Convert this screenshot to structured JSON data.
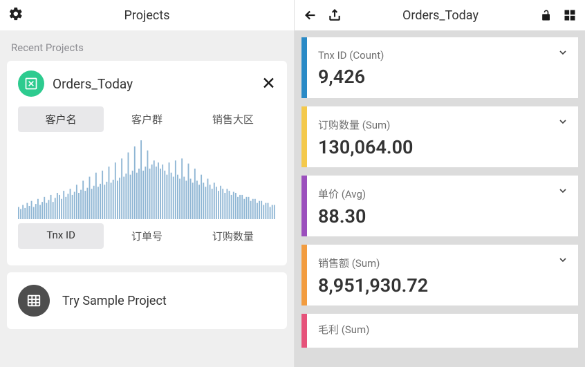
{
  "left": {
    "title": "Projects",
    "recent_label": "Recent Projects",
    "project": {
      "name": "Orders_Today",
      "tabs_top": [
        "客户名",
        "客户群",
        "销售大区"
      ],
      "tabs_bottom": [
        "Tnx ID",
        "订单号",
        "订购数量"
      ],
      "active_top": 0,
      "active_bottom": 0
    },
    "sample_label": "Try Sample Project"
  },
  "right": {
    "title": "Orders_Today",
    "metrics": [
      {
        "label": "Tnx ID (Count)",
        "value": "9,426",
        "color": "#2a8ac6"
      },
      {
        "label": "订购数量 (Sum)",
        "value": "130,064.00",
        "color": "#f4c94b"
      },
      {
        "label": "单价 (Avg)",
        "value": "88.30",
        "color": "#9b4fbd"
      },
      {
        "label": "销售额 (Sum)",
        "value": "8,951,930.72",
        "color": "#f29c3f"
      },
      {
        "label": "毛利 (Sum)",
        "value": "",
        "color": "#e6527a"
      }
    ]
  },
  "chart_data": {
    "type": "bar",
    "note": "Dense distribution of many vertical bars, approximate heights estimated from pixels (0-100 scale).",
    "values": [
      12,
      10,
      14,
      11,
      16,
      13,
      18,
      12,
      15,
      20,
      14,
      17,
      22,
      16,
      19,
      24,
      17,
      21,
      26,
      24,
      20,
      28,
      22,
      25,
      30,
      24,
      27,
      34,
      26,
      29,
      38,
      28,
      31,
      42,
      30,
      33,
      46,
      32,
      35,
      48,
      34,
      37,
      52,
      36,
      39,
      56,
      38,
      41,
      60,
      42,
      45,
      66,
      44,
      48,
      72,
      46,
      50,
      78,
      48,
      52,
      68,
      50,
      54,
      58,
      52,
      56,
      50,
      54,
      48,
      44,
      56,
      46,
      42,
      58,
      44,
      40,
      60,
      42,
      38,
      55,
      40,
      36,
      50,
      38,
      34,
      44,
      36,
      32,
      40,
      34,
      30,
      36,
      32,
      28,
      33,
      30,
      26,
      30,
      28,
      24,
      27,
      26,
      22,
      24,
      24,
      20,
      22,
      22,
      18,
      20,
      20,
      16,
      18,
      18,
      14,
      16,
      16,
      12,
      14,
      14
    ]
  }
}
